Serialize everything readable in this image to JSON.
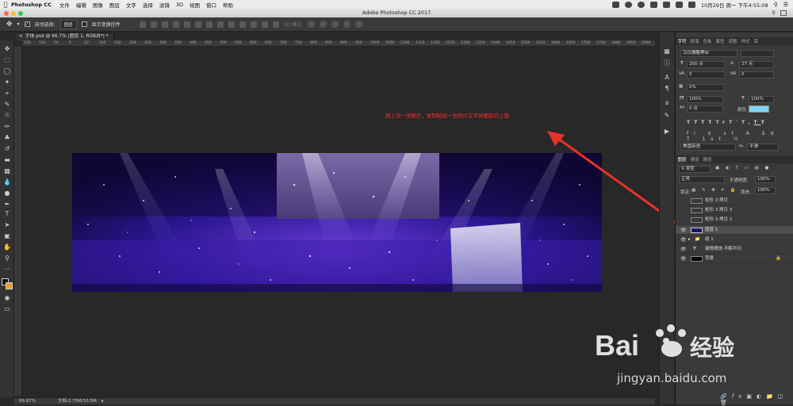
{
  "menubar": {
    "app_name": "Photoshop CC",
    "items": [
      "文件",
      "编辑",
      "图像",
      "图层",
      "文字",
      "选择",
      "滤镜",
      "3D",
      "视图",
      "窗口",
      "帮助"
    ],
    "clock": "10月29日 周一 下午4:55:08"
  },
  "window": {
    "title": "Adobe Photoshop CC 2017"
  },
  "options": {
    "auto_select_label": "自动选择:",
    "auto_select_value": "图层",
    "show_transform_label": "显示变换控件",
    "mode_3d_label": "3D 模式:"
  },
  "document": {
    "tab_label": "字体.psd @ 66.7% (图层 1, RGB/8*) *",
    "ruler_ticks": [
      "150",
      "100",
      "50",
      "0",
      "50",
      "100",
      "150",
      "200",
      "250",
      "300",
      "350",
      "400",
      "450",
      "500",
      "550",
      "600",
      "650",
      "700",
      "750",
      "800",
      "850",
      "900",
      "950",
      "1000",
      "1050",
      "1100",
      "1150",
      "1200",
      "1250",
      "1300",
      "1350",
      "1400",
      "1450",
      "1500",
      "1550",
      "1600",
      "1650",
      "1700",
      "1750",
      "1800",
      "1850",
      "1900"
    ]
  },
  "annotation": {
    "text": "网上找一张图片，复制粘贴一张图片在字体图层的上面"
  },
  "status": {
    "zoom": "66.67%",
    "doc_size": "文档:2.75M/10.5M"
  },
  "character_panel": {
    "tabs": [
      "字符",
      "段落",
      "色板",
      "属性",
      "调整",
      "样式",
      "库"
    ],
    "font": "汉仪雅酷黑W",
    "font_size": "200 点",
    "leading": "27 点",
    "tracking_left": "0",
    "tracking_right": "0",
    "kerning": "0%",
    "vscale": "100%",
    "hscale": "100%",
    "baseline": "0 点",
    "color_label": "颜色:",
    "color_swatch": "#7ed6f7",
    "style_buttons": [
      "T",
      "T",
      "TT",
      "Tr",
      "T'",
      "T,",
      "T",
      "Ŧ"
    ],
    "language": "美国英语",
    "aa_label": "aₐ",
    "aa_value": "平滑"
  },
  "layers_panel": {
    "tabs": [
      "图层",
      "通道",
      "路径"
    ],
    "filter": "类型",
    "blend_mode": "正常",
    "opacity_label": "不透明度:",
    "opacity_value": "100%",
    "lock_label": "锁定:",
    "fill_label": "填充:",
    "fill_value": "100%",
    "layers": [
      {
        "name": "矩形 3 拷贝",
        "type": "shape",
        "visible": false
      },
      {
        "name": "矩形 3 拷贝 3",
        "type": "shape",
        "visible": false
      },
      {
        "name": "矩形 3 拷贝 2",
        "type": "shape",
        "visible": false
      },
      {
        "name": "图层 1",
        "type": "image",
        "visible": true,
        "selected": true
      },
      {
        "name": "组 1",
        "type": "group",
        "visible": true
      },
      {
        "name": "激情燃烧 不眠不归",
        "type": "text",
        "visible": true
      },
      {
        "name": "背景",
        "type": "fill",
        "visible": true,
        "locked": true
      }
    ],
    "bottom_icons": [
      "link-icon",
      "fx-icon",
      "mask-icon",
      "adjustment-icon",
      "folder-icon",
      "new-layer-icon",
      "trash-icon"
    ]
  },
  "watermark": {
    "brand": "Bai",
    "brand_cn": "经验",
    "url": "jingyan.baidu.com"
  },
  "colors": {
    "accent_red": "#e8322c",
    "panel_bg": "#3a3a3a",
    "canvas_bg": "#282828"
  }
}
